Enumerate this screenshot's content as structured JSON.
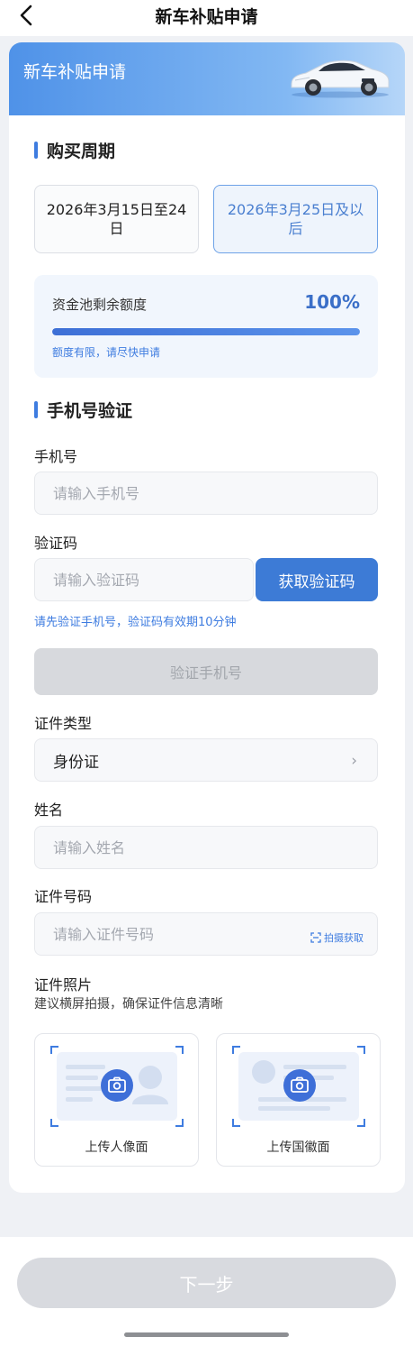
{
  "nav": {
    "title": "新车补贴申请"
  },
  "banner": {
    "title": "新车补贴申请"
  },
  "purchase_period": {
    "title": "购买周期",
    "options": [
      {
        "label": "2026年3月15日至24日",
        "selected": false
      },
      {
        "label": "2026年3月25日及以后",
        "selected": true
      }
    ]
  },
  "fund_pool": {
    "label": "资金池剩余额度",
    "percent_text": "100%",
    "remaining_fraction": 1.0,
    "note": "额度有限，请尽快申请"
  },
  "phone_verify": {
    "title": "手机号验证",
    "phone_label": "手机号",
    "phone_placeholder": "请输入手机号",
    "phone_value": "",
    "code_label": "验证码",
    "code_placeholder": "请输入验证码",
    "code_value": "",
    "get_code_label": "获取验证码",
    "hint": "请先验证手机号，验证码有效期10分钟",
    "verify_label": "验证手机号"
  },
  "id_type": {
    "label": "证件类型",
    "value": "身份证"
  },
  "name_field": {
    "label": "姓名",
    "placeholder": "请输入姓名",
    "value": ""
  },
  "id_number": {
    "label": "证件号码",
    "placeholder": "请输入证件号码",
    "value": "",
    "scan_label": "拍摄获取"
  },
  "id_photo": {
    "label": "证件照片",
    "hint": "建议横屏拍摄，确保证件信息清晰",
    "front_label": "上传人像面",
    "back_label": "上传国徽面"
  },
  "footer": {
    "next_label": "下一步"
  },
  "colors": {
    "accent": "#3e7ce0",
    "disabled": "#d7d9dd",
    "page_bg": "#eff1f5"
  },
  "icons": {
    "back": "chevron-left-icon",
    "select_arrow": "chevron-right-icon",
    "scan": "scan-icon",
    "camera": "camera-icon"
  }
}
